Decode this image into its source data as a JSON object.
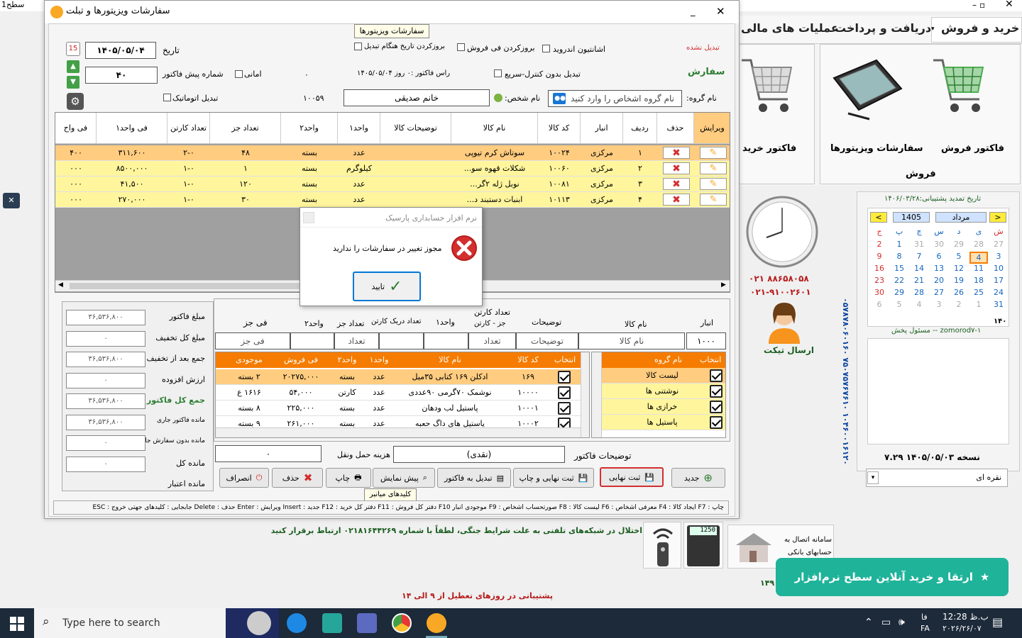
{
  "bg": {
    "title_fragment": "سطح1",
    "menu": [
      "خرید و فروش",
      "دریافت و پرداخت",
      "عملیات های مالی"
    ],
    "ribbon": {
      "item1": "فاکتور فروش",
      "item2": "سفارشات ویزیتورها",
      "item3": "فاکتور خرید",
      "group": "فروش"
    },
    "phone1": "۰۲۱ ۸۸۶۵۸۰۵۸",
    "phone2": "۰۲۱-۹۱۰۰۲۶۰۱",
    "ticket": "ارسال تیکت",
    "support_date": "تاریخ تمدید پشتیبانی:۱۴۰۶/۰۳/۲۸",
    "calendar": {
      "year": "1405",
      "month": "مرداد",
      "prev": "<",
      "next": ">",
      "weekdays": [
        "ش",
        "ی",
        "د",
        "س",
        "چ",
        "پ",
        "ج"
      ],
      "rows": [
        [
          "27",
          "28",
          "29",
          "30",
          "31",
          "1",
          "2"
        ],
        [
          "3",
          "4",
          "5",
          "6",
          "7",
          "8",
          "9"
        ],
        [
          "10",
          "11",
          "12",
          "13",
          "14",
          "15",
          "16"
        ],
        [
          "17",
          "18",
          "19",
          "20",
          "21",
          "22",
          "23"
        ],
        [
          "24",
          "25",
          "26",
          "27",
          "28",
          "29",
          "30"
        ],
        [
          "31",
          "1",
          "2",
          "3",
          "4",
          "5",
          "6"
        ]
      ],
      "code": "۱۴۰"
    },
    "user": "zomorod۷-۱ -- مسئول پخش",
    "version": "نسخه ۱۴۰۵/۰۵/۰۳ ۷.۲۹",
    "combo": "نقره ای",
    "vertical_numbers": "۰۵۷۸۷۸۰۶۰۱۶۰   ۷۵۰۷۵۷۶۷۶۱۰   ۱۰۴۶۰۰۱۶۱۲۰",
    "bank": "سامانه اتصال به حسابهای بانکی",
    "calc_display": "1250",
    "notice": "اختلال در شبکه‌های تلفنی به علت شرایط جنگی، لطفاً با شماره ۰۲۱۸۱۶۴۴۲۶۹ ارتباط برقرار کنید",
    "support_hours": "پشتیبانی در روزهای تعطیل از ۹ الی ۱۴",
    "side_num": "۱۴۹",
    "promo": "ارتقا و خرید آنلاین سطح نرم‌افزار"
  },
  "win": {
    "title": "سفارشات ویزیتورها و تبلت",
    "tooltip": "سفارشات ویزیتورها",
    "status_red": "تبدیل نشده",
    "order_label": "سفارش",
    "date_label": "تاریخ",
    "date_value": "۱۴۰۵/۰۵/۰۴",
    "prefactor_label": "شماره پیش فاکتور",
    "prefactor_value": "۴۰",
    "amani": "امانی",
    "auto_convert": "تبدیل اتوماتیک",
    "update_date": "بروزکردن تاریخ هنگام تبدیل",
    "update_price": "بروزکردن فی فروش",
    "android": "اشانتیون اندروید",
    "convert_nocontrol": "تبدیل بدون کنترل-سریع",
    "zero": "۰",
    "due": "راس فاکتور :۰ روز ۱۴۰۵/۰۵/۰۴",
    "code": "۱۰۰۵۹",
    "group_label": "نام گروه:",
    "group_placeholder": "نام گروه اشخاص را وارد کنید",
    "person_label": "نام شخص:",
    "person_value": "خانم صدیقی",
    "columns": [
      "ویرایش",
      "حذف",
      "ردیف",
      "انبار",
      "کد کالا",
      "نام کالا",
      "توضیحات کالا",
      "واحد۱",
      "واحد۲",
      "تعداد جز",
      "تعداد کارتن",
      "فی واحد۱",
      "فی واح"
    ],
    "rows": [
      [
        "۱",
        "مرکزی",
        "۱۰۰۲۴",
        "سوتاش کرم تیوپی",
        "",
        "عدد",
        "بسته",
        "۴۸",
        "۲-۰",
        "۳۱۱,۶۰۰",
        "۴۰۰"
      ],
      [
        "۲",
        "مرکزی",
        "۱۰۰۶۰",
        "شکلات قهوه سو...",
        "",
        "کیلوگرم",
        "بسته",
        "۱",
        "۱-۰",
        "۸۵۰۰,۰۰۰",
        "۰۰۰"
      ],
      [
        "۳",
        "مرکزی",
        "۱۰۰۸۱",
        "نوبل ژله ۲گر...",
        "",
        "عدد",
        "بسته",
        "۱۲۰",
        "۱-۰",
        "۴۱,۵۰۰",
        "۰۰۰"
      ],
      [
        "۴",
        "مرکزی",
        "۱۰۱۱۳",
        "ابنبات دستبند د...",
        "",
        "عدد",
        "بسته",
        "۳۰",
        "۱-۰",
        "۲۷۰,۰۰۰",
        "۰۰۰"
      ]
    ],
    "summary": [
      {
        "label": "مبلغ فاکتور",
        "value": "۳۶,۵۳۶,۸۰۰"
      },
      {
        "label": "مبلغ کل تخفیف",
        "value": "۰"
      },
      {
        "label": "جمع بعد از تخفیف",
        "value": "۳۶,۵۳۶,۸۰۰"
      },
      {
        "label": "ارزش افزوده",
        "value": "۰"
      },
      {
        "label": "جمع کل فاکتور",
        "value": "۳۶,۵۳۶,۸۰۰"
      },
      {
        "label": "مانده فاکتور جاری",
        "value": "۳۶,۵۳۶,۸۰۰"
      },
      {
        "label": "مانده بدون سفارش جاری",
        "value": "۰"
      },
      {
        "label": "مانده کل",
        "value": "۰"
      },
      {
        "label": "مانده اعتبار",
        "value": ""
      }
    ],
    "entry": {
      "anbar": "انبار",
      "anbar_val": "۱۰۰۰",
      "name": "نام کالا",
      "name_ph": "نام کالا",
      "desc": "توضیحات",
      "desc_ph": "توضیحات",
      "carton_count": "تعداد کارتن",
      "carton_sub": "جز - کارتن",
      "count_ph": "تعداد",
      "unit1": "واحد۱",
      "per_carton": "تعداد دریک کارتن",
      "part_count": "تعداد جز",
      "part_ph": "تعداد",
      "unit2": "واحد۲",
      "part_price": "فی جز",
      "part_price_ph": "فی جز"
    },
    "groups_cols": [
      "انتخاب",
      "نام گروه"
    ],
    "groups": [
      "لیست کالا",
      "نوشتنی ها",
      "خرازی ها",
      "پاستیل ها"
    ],
    "items_cols": [
      "انتخاب",
      "کد کالا",
      "نام کالا",
      "واحد۱",
      "واحد۲",
      "فی فروش",
      "موجودی"
    ],
    "items": [
      [
        "۱۶۹",
        "ادکلن ۱۶۹ کتابی ۳۵میل",
        "عدد",
        "بسته",
        "۲۰۲۷۵,۰۰۰",
        "۲ بسته"
      ],
      [
        "۱۰۰۰۰",
        "نوشمک ۷۰گرمی ۹۰عددی",
        "عدد",
        "کارتن",
        "۵۴,۰۰۰",
        "۱۶۱۶ ع"
      ],
      [
        "۱۰۰۰۱",
        "پاستیل لب ودهان",
        "عدد",
        "بسته",
        "۲۲۵,۰۰۰",
        "۸ بسته"
      ],
      [
        "۱۰۰۰۲",
        "پاستیل های داگ حعبه",
        "عدد",
        "بسته",
        "۲۶۱,۰۰۰",
        "۹ بسته"
      ]
    ],
    "freight_label": "هزینه حمل ونقل",
    "freight_value": "۰",
    "invoice_desc_label": "توضیحات فاکتور",
    "invoice_desc_value": "(نقدی)",
    "buttons": {
      "new": "جدید",
      "final": "ثبت نهایی",
      "final_print": "ثبت نهایی و چاپ",
      "convert": "تبدیل به فاکتور",
      "preview": "پیش نمایش",
      "print": "چاپ",
      "delete": "حذف",
      "cancel": "انصراف"
    },
    "shortcut_tooltip": "کلیدهای میانبر",
    "shortcuts": "چاپ : F7 ایجاد کالا : F4 معرفی اشخاص : F6 لیست کالا : F8 صورتحساب اشخاص : F9 موجودی انبار F10 دفتر کل فروش : F11 دفتر کل خرید : F12 جدید : Insert ویرایش : Enter حذف : Delete جابجایی : کلیدهای جهتی خروج : ESC"
  },
  "error": {
    "title": "نرم افزار حسابداری پارسیک",
    "message": "مجوز تغییر در سفارشات را ندارید",
    "ok": "تایید"
  },
  "taskbar": {
    "search": "Type here to search",
    "lang": "فا",
    "lang2": "FA",
    "time": "12:28 ب.ظ",
    "date": "۲۰۲۶/۲۶/۰۷"
  }
}
